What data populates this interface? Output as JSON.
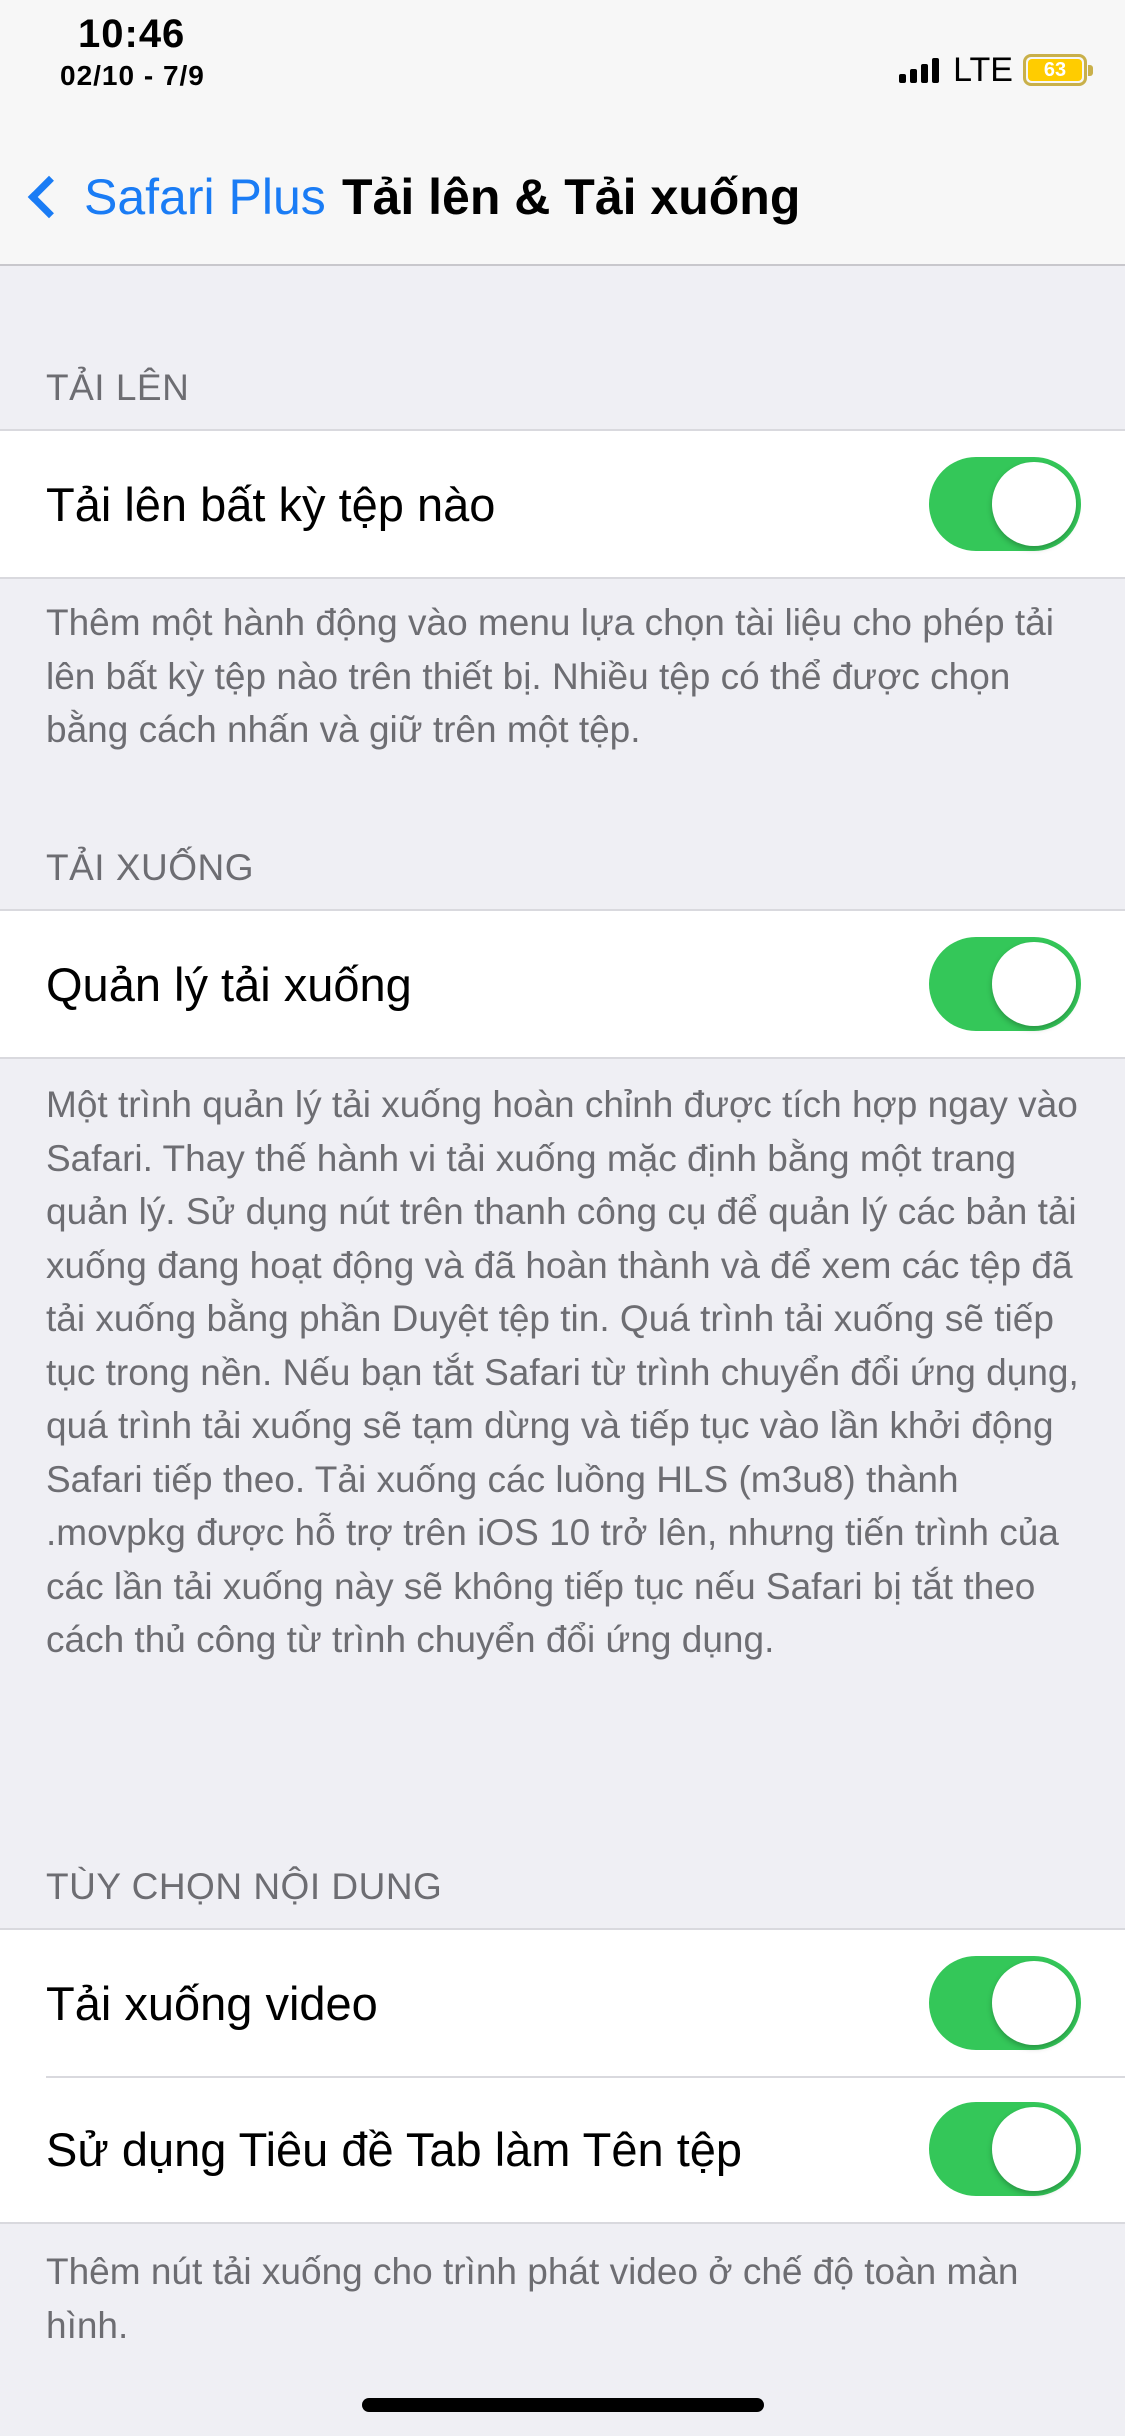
{
  "status_bar": {
    "time": "10:46",
    "date": "02/10 - 7/9",
    "network": "LTE",
    "battery_level": "63",
    "battery_color": "#ffcc00"
  },
  "nav": {
    "back_label": "Safari Plus",
    "title": "Tải lên & Tải xuống",
    "accent_color": "#1a7cf5"
  },
  "sections": {
    "upload": {
      "header": "TẢI LÊN",
      "rows": [
        {
          "label": "Tải lên bất kỳ tệp nào",
          "enabled": true
        }
      ],
      "footer": "Thêm một hành động vào menu lựa chọn tài liệu cho phép tải lên bất kỳ tệp nào trên thiết bị. Nhiều tệp có thể được chọn bằng cách nhấn và giữ trên một tệp."
    },
    "download": {
      "header": "TẢI XUỐNG",
      "rows": [
        {
          "label": "Quản lý tải xuống",
          "enabled": true
        }
      ],
      "footer": "Một trình quản lý tải xuống hoàn chỉnh được tích hợp ngay vào Safari. Thay thế hành vi tải xuống mặc định bằng một trang quản lý. Sử dụng nút trên thanh công cụ để quản lý các bản tải xuống đang hoạt động và đã hoàn thành và để xem các tệp đã tải xuống bằng phần Duyệt tệp tin. Quá trình tải xuống sẽ tiếp tục trong nền. Nếu bạn tắt Safari từ trình chuyển đổi ứng dụng, quá trình tải xuống sẽ tạm dừng và tiếp tục vào lần khởi động Safari tiếp theo. Tải xuống các luồng HLS (m3u8) thành .movpkg được hỗ trợ trên iOS 10 trở lên, nhưng tiến trình của các lần tải xuống này sẽ không tiếp tục nếu Safari bị tắt theo cách thủ công từ trình chuyển đổi ứng dụng."
    },
    "content": {
      "header": "TÙY CHỌN NỘI DUNG",
      "rows": [
        {
          "label": "Tải xuống video",
          "enabled": true
        },
        {
          "label": "Sử dụng Tiêu đề Tab làm Tên tệp",
          "enabled": true
        }
      ],
      "footer": "Thêm nút tải xuống cho trình phát video ở chế độ toàn màn hình."
    }
  },
  "toggle_on_color": "#34c759"
}
